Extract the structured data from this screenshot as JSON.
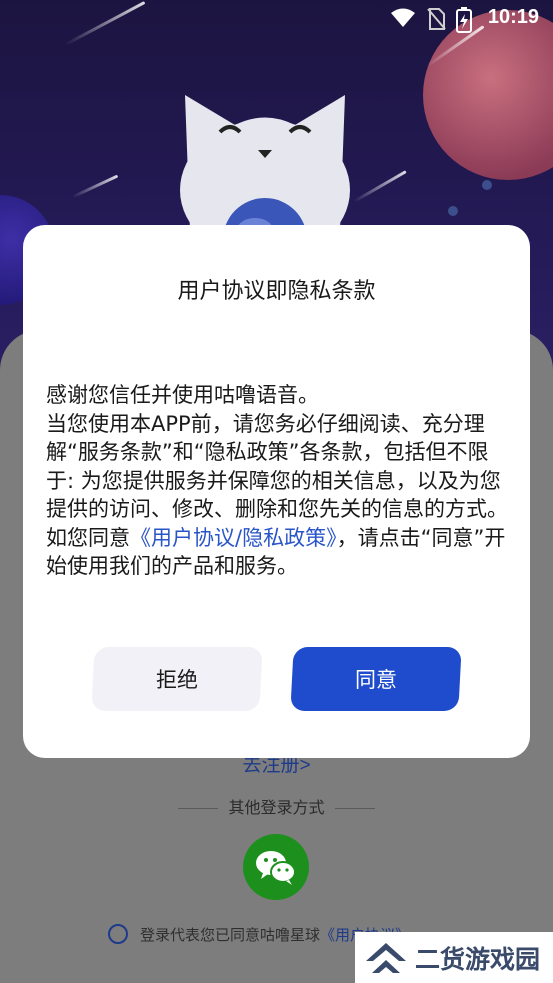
{
  "status_bar": {
    "time": "10:19",
    "icons": [
      "wifi-icon",
      "no-sim-icon",
      "battery-charging-icon"
    ]
  },
  "background": {
    "register_link": "去注册>",
    "other_login_label": "其他登录方式",
    "wechat_icon": "wechat-icon",
    "agree_text": "登录代表您已同意咕噜星球",
    "agree_link": "《用户协议》"
  },
  "dialog": {
    "title": "用户协议即隐私条款",
    "body_intro": "感谢您信任并使用咕噜语音。",
    "body_main": "当您使用本APP前，请您务必仔细阅读、充分理解“服务条款”和“隐私政策”各条款，包括但不限于: 为您提供服务并保障您的相关信息，以及为您提供的访问、修改、删除和您先关的信息的方式。如您同意",
    "body_link": "《用户协议/隐私政策》",
    "body_tail": "，请点击“同意”开始使用我们的产品和服务。",
    "reject_label": "拒绝",
    "agree_label": "同意"
  },
  "watermark": {
    "text": "二货游戏园"
  },
  "colors": {
    "primary": "#1f4ccc",
    "link": "#2a55c8",
    "wechat": "#1d8f1d"
  }
}
